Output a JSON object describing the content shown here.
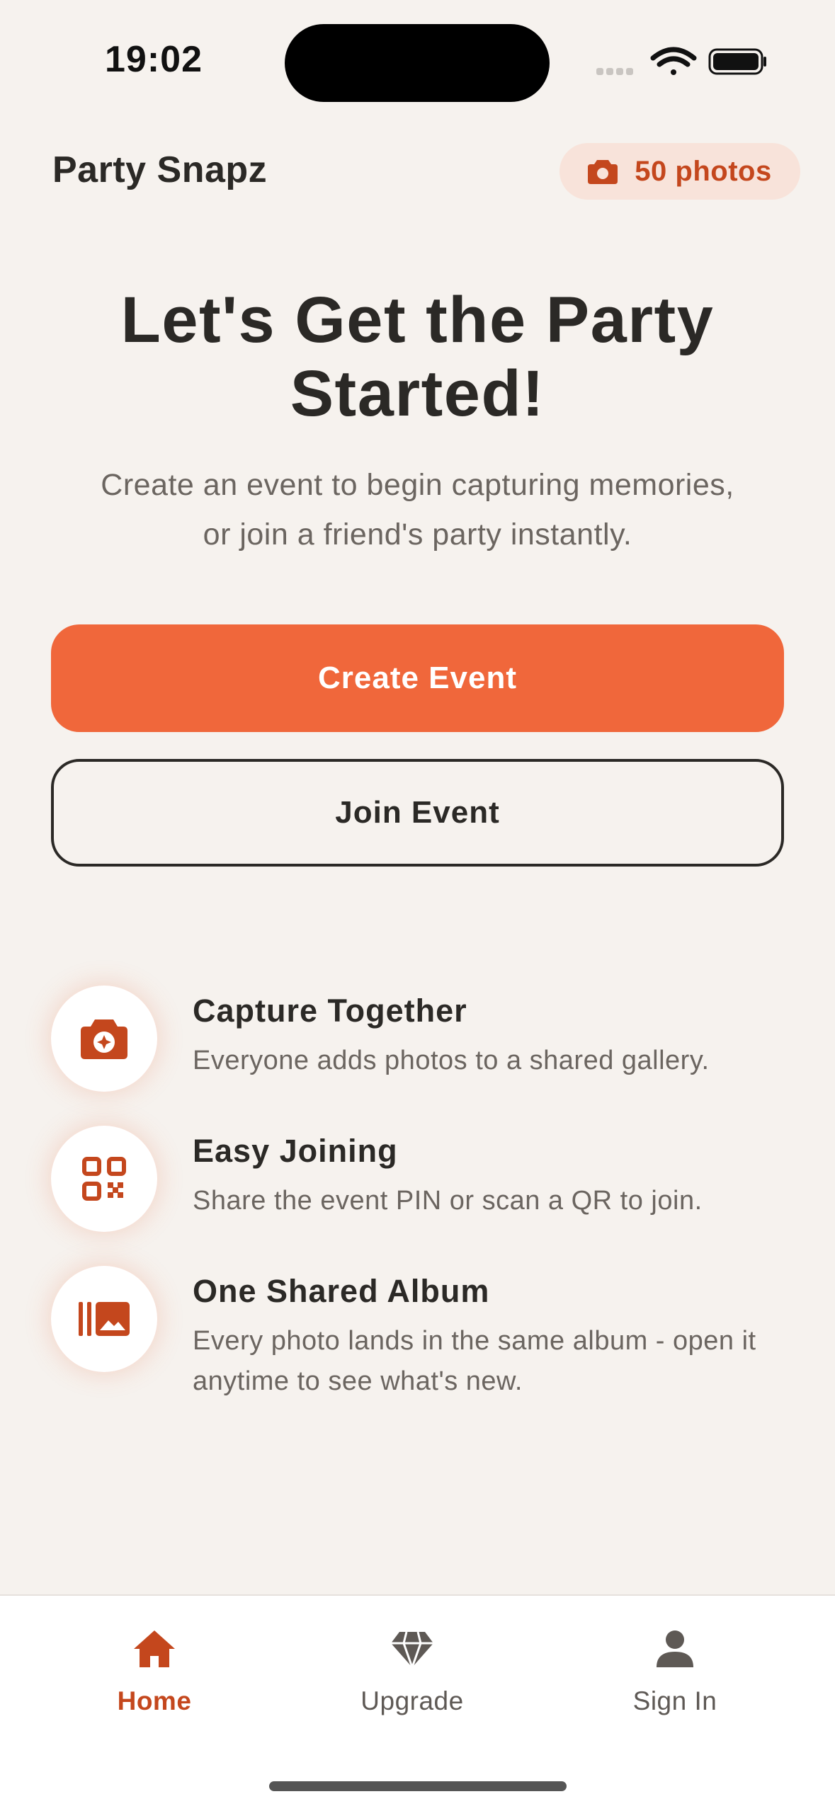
{
  "status_bar": {
    "time": "19:02",
    "icons": [
      "signal-icon",
      "wifi-icon",
      "battery-icon"
    ]
  },
  "header": {
    "app_title": "Party Snapz",
    "photos_badge": {
      "icon": "camera-icon",
      "label": "50 photos"
    }
  },
  "hero": {
    "title_line1": "Let's Get the Party",
    "title_line2": "Started!",
    "subtitle_line1": "Create an event to begin capturing memories,",
    "subtitle_line2": "or join a friend's party instantly."
  },
  "actions": {
    "create_label": "Create Event",
    "join_label": "Join Event"
  },
  "features": [
    {
      "icon": "camera-icon",
      "title": "Capture Together",
      "desc": "Everyone adds photos to a shared gallery."
    },
    {
      "icon": "qr-code-icon",
      "title": "Easy Joining",
      "desc": "Share the event PIN or scan a QR to join."
    },
    {
      "icon": "photo-album-icon",
      "title": "One Shared Album",
      "desc": "Every photo lands in the same album - open it anytime to see what's new."
    }
  ],
  "tab_bar": {
    "items": [
      {
        "icon": "home-icon",
        "label": "Home",
        "active": true
      },
      {
        "icon": "diamond-icon",
        "label": "Upgrade",
        "active": false
      },
      {
        "icon": "person-icon",
        "label": "Sign In",
        "active": false
      }
    ]
  },
  "colors": {
    "accent": "#f0673b",
    "accent_dark": "#c4471d",
    "background": "#f6f2ee",
    "text": "#2b2926",
    "muted": "#6b6560"
  }
}
